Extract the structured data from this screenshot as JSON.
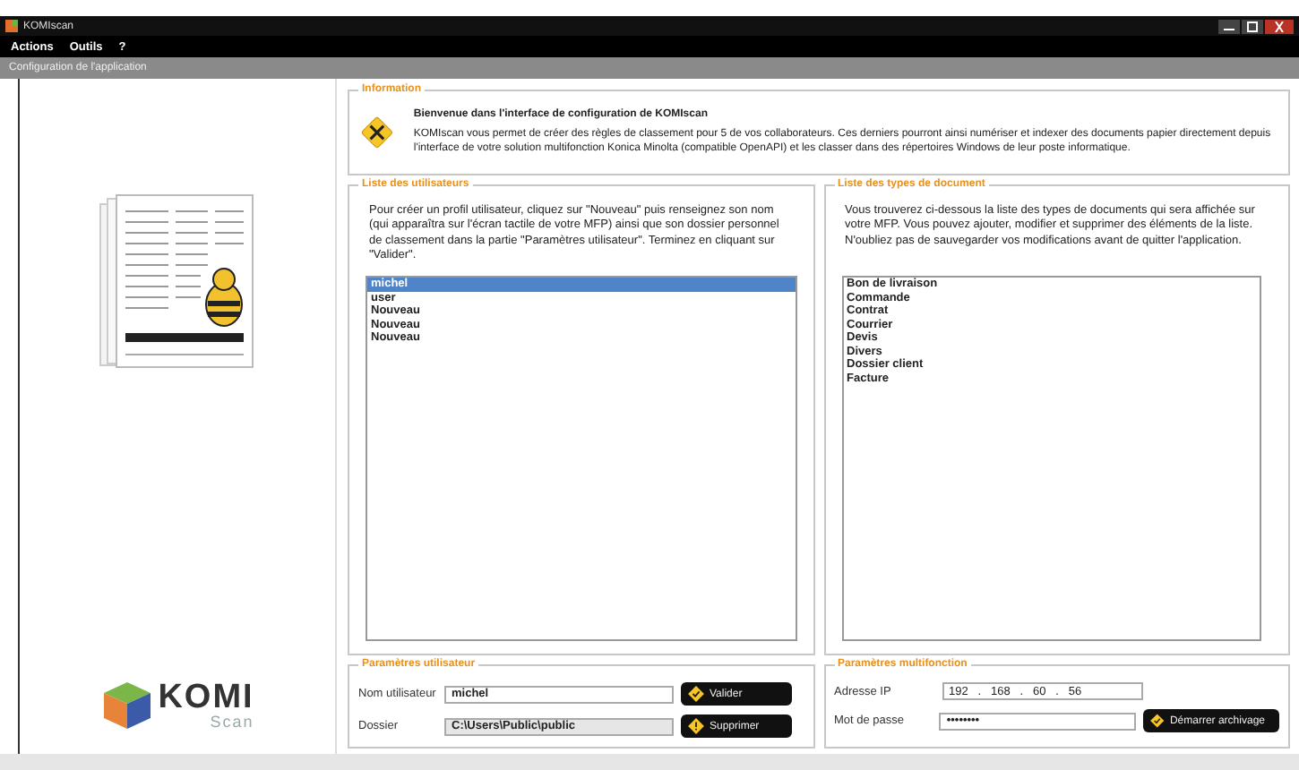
{
  "window": {
    "title": "KOMIscan"
  },
  "menu": [
    "Actions",
    "Outils",
    "?"
  ],
  "header": "Configuration de l'application",
  "logo": {
    "main": "KOMI",
    "sub": "Scan"
  },
  "information": {
    "legend": "Information",
    "heading": "Bienvenue dans l'interface de configuration de KOMIscan",
    "text": "KOMIscan vous permet de créer des règles de classement pour 5 de vos collaborateurs. Ces derniers pourront ainsi numériser et indexer des documents papier directement depuis l'interface de votre solution multifonction Konica Minolta (compatible OpenAPI) et les classer dans des répertoires Windows de leur poste informatique."
  },
  "users": {
    "legend": "Liste des utilisateurs",
    "text": "Pour créer un profil utilisateur, cliquez sur \"Nouveau\" puis renseignez son nom (qui apparaîtra sur l'écran tactile de votre MFP) ainsi que son dossier personnel de classement dans la partie \"Paramètres utilisateur\". Terminez en cliquant sur \"Valider\".",
    "items": [
      {
        "label": "michel",
        "selected": true
      },
      {
        "label": "user",
        "selected": false
      },
      {
        "label": "Nouveau",
        "selected": false
      },
      {
        "label": "Nouveau",
        "selected": false
      },
      {
        "label": "Nouveau",
        "selected": false
      }
    ]
  },
  "doc_types": {
    "legend": "Liste des types de document",
    "text": "Vous trouverez ci-dessous la liste des types de documents qui sera affichée sur votre MFP. Vous pouvez ajouter, modifier et supprimer des éléments de la liste. N'oubliez pas de sauvegarder vos modifications avant de quitter l'application.",
    "items": [
      {
        "label": "Bon de livraison",
        "selected": false
      },
      {
        "label": "Commande",
        "selected": false
      },
      {
        "label": "Contrat",
        "selected": false
      },
      {
        "label": "Courrier",
        "selected": false
      },
      {
        "label": "Devis",
        "selected": false
      },
      {
        "label": "Divers",
        "selected": false
      },
      {
        "label": "Dossier client",
        "selected": false
      },
      {
        "label": "Facture",
        "selected": false
      }
    ]
  },
  "user_params": {
    "legend": "Paramètres utilisateur",
    "fields": [
      {
        "label": "Nom utilisateur",
        "value": "michel",
        "disabled": false
      },
      {
        "label": "Dossier",
        "value": "C:\\Users\\Public\\public",
        "disabled": true
      }
    ],
    "buttons": [
      {
        "label": "Valider",
        "kind": "check"
      },
      {
        "label": "Supprimer",
        "kind": "warn"
      }
    ]
  },
  "device_params": {
    "legend": "Paramètres multifonction",
    "ip_label": "Adresse IP",
    "ip": "192   .   168   .   60   .   56",
    "password_label": "Mot de passe",
    "password": "••••••••",
    "button": "Démarrer archivage"
  }
}
